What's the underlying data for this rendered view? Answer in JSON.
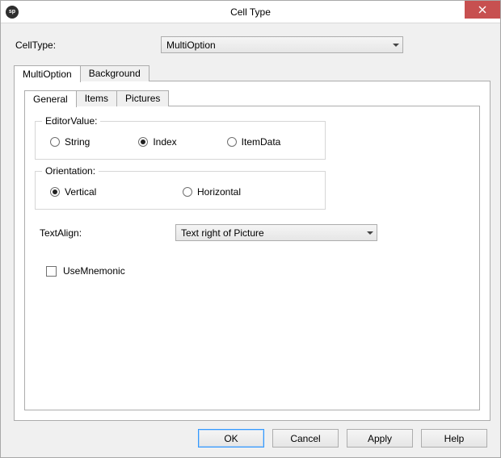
{
  "window": {
    "title": "Cell Type",
    "appicon_text": "sp"
  },
  "celltype": {
    "label": "CellType:",
    "value": "MultiOption"
  },
  "outer_tabs": {
    "items": [
      {
        "label": "MultiOption",
        "active": true
      },
      {
        "label": "Background",
        "active": false
      }
    ]
  },
  "inner_tabs": {
    "items": [
      {
        "label": "General",
        "active": true
      },
      {
        "label": "Items",
        "active": false
      },
      {
        "label": "Pictures",
        "active": false
      }
    ]
  },
  "editor_value": {
    "legend": "EditorValue:",
    "options": [
      {
        "label": "String",
        "checked": false
      },
      {
        "label": "Index",
        "checked": true
      },
      {
        "label": "ItemData",
        "checked": false
      }
    ]
  },
  "orientation": {
    "legend": "Orientation:",
    "options": [
      {
        "label": "Vertical",
        "checked": true
      },
      {
        "label": "Horizontal",
        "checked": false
      }
    ]
  },
  "text_align": {
    "label": "TextAlign:",
    "value": "Text right of Picture"
  },
  "use_mnemonic": {
    "label": "UseMnemonic",
    "checked": false
  },
  "buttons": {
    "ok": "OK",
    "cancel": "Cancel",
    "apply": "Apply",
    "help": "Help"
  }
}
